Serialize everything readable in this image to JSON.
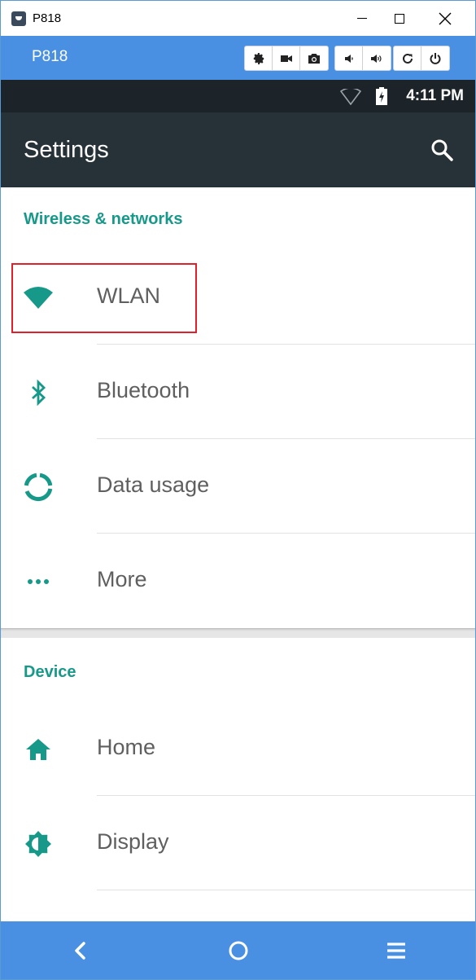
{
  "window": {
    "title": "P818",
    "controls": [
      "minimize",
      "maximize",
      "close"
    ]
  },
  "toolbar": {
    "device_label": "P818",
    "buttons": [
      "gear-icon",
      "video-camera-icon",
      "camera-icon",
      "volume-down-icon",
      "volume-up-icon",
      "rotate-icon",
      "power-icon"
    ]
  },
  "statusbar": {
    "time": "4:11 PM"
  },
  "appbar": {
    "title": "Settings"
  },
  "sections": [
    {
      "header": "Wireless & networks",
      "items": [
        {
          "label": "WLAN",
          "icon": "wifi-icon"
        },
        {
          "label": "Bluetooth",
          "icon": "bluetooth-icon"
        },
        {
          "label": "Data usage",
          "icon": "data-usage-icon"
        },
        {
          "label": "More",
          "icon": "more-dots-icon"
        }
      ]
    },
    {
      "header": "Device",
      "items": [
        {
          "label": "Home",
          "icon": "home-icon"
        },
        {
          "label": "Display",
          "icon": "display-brightness-icon"
        }
      ]
    }
  ],
  "navbar": {
    "buttons": [
      "back-icon",
      "home-circle-icon",
      "menu-icon"
    ]
  },
  "colors": {
    "accent": "#17998a",
    "toolbar_blue": "#4a90e2",
    "statusbar": "#1c2429",
    "appbar": "#263238",
    "highlight": "#e0202a"
  }
}
